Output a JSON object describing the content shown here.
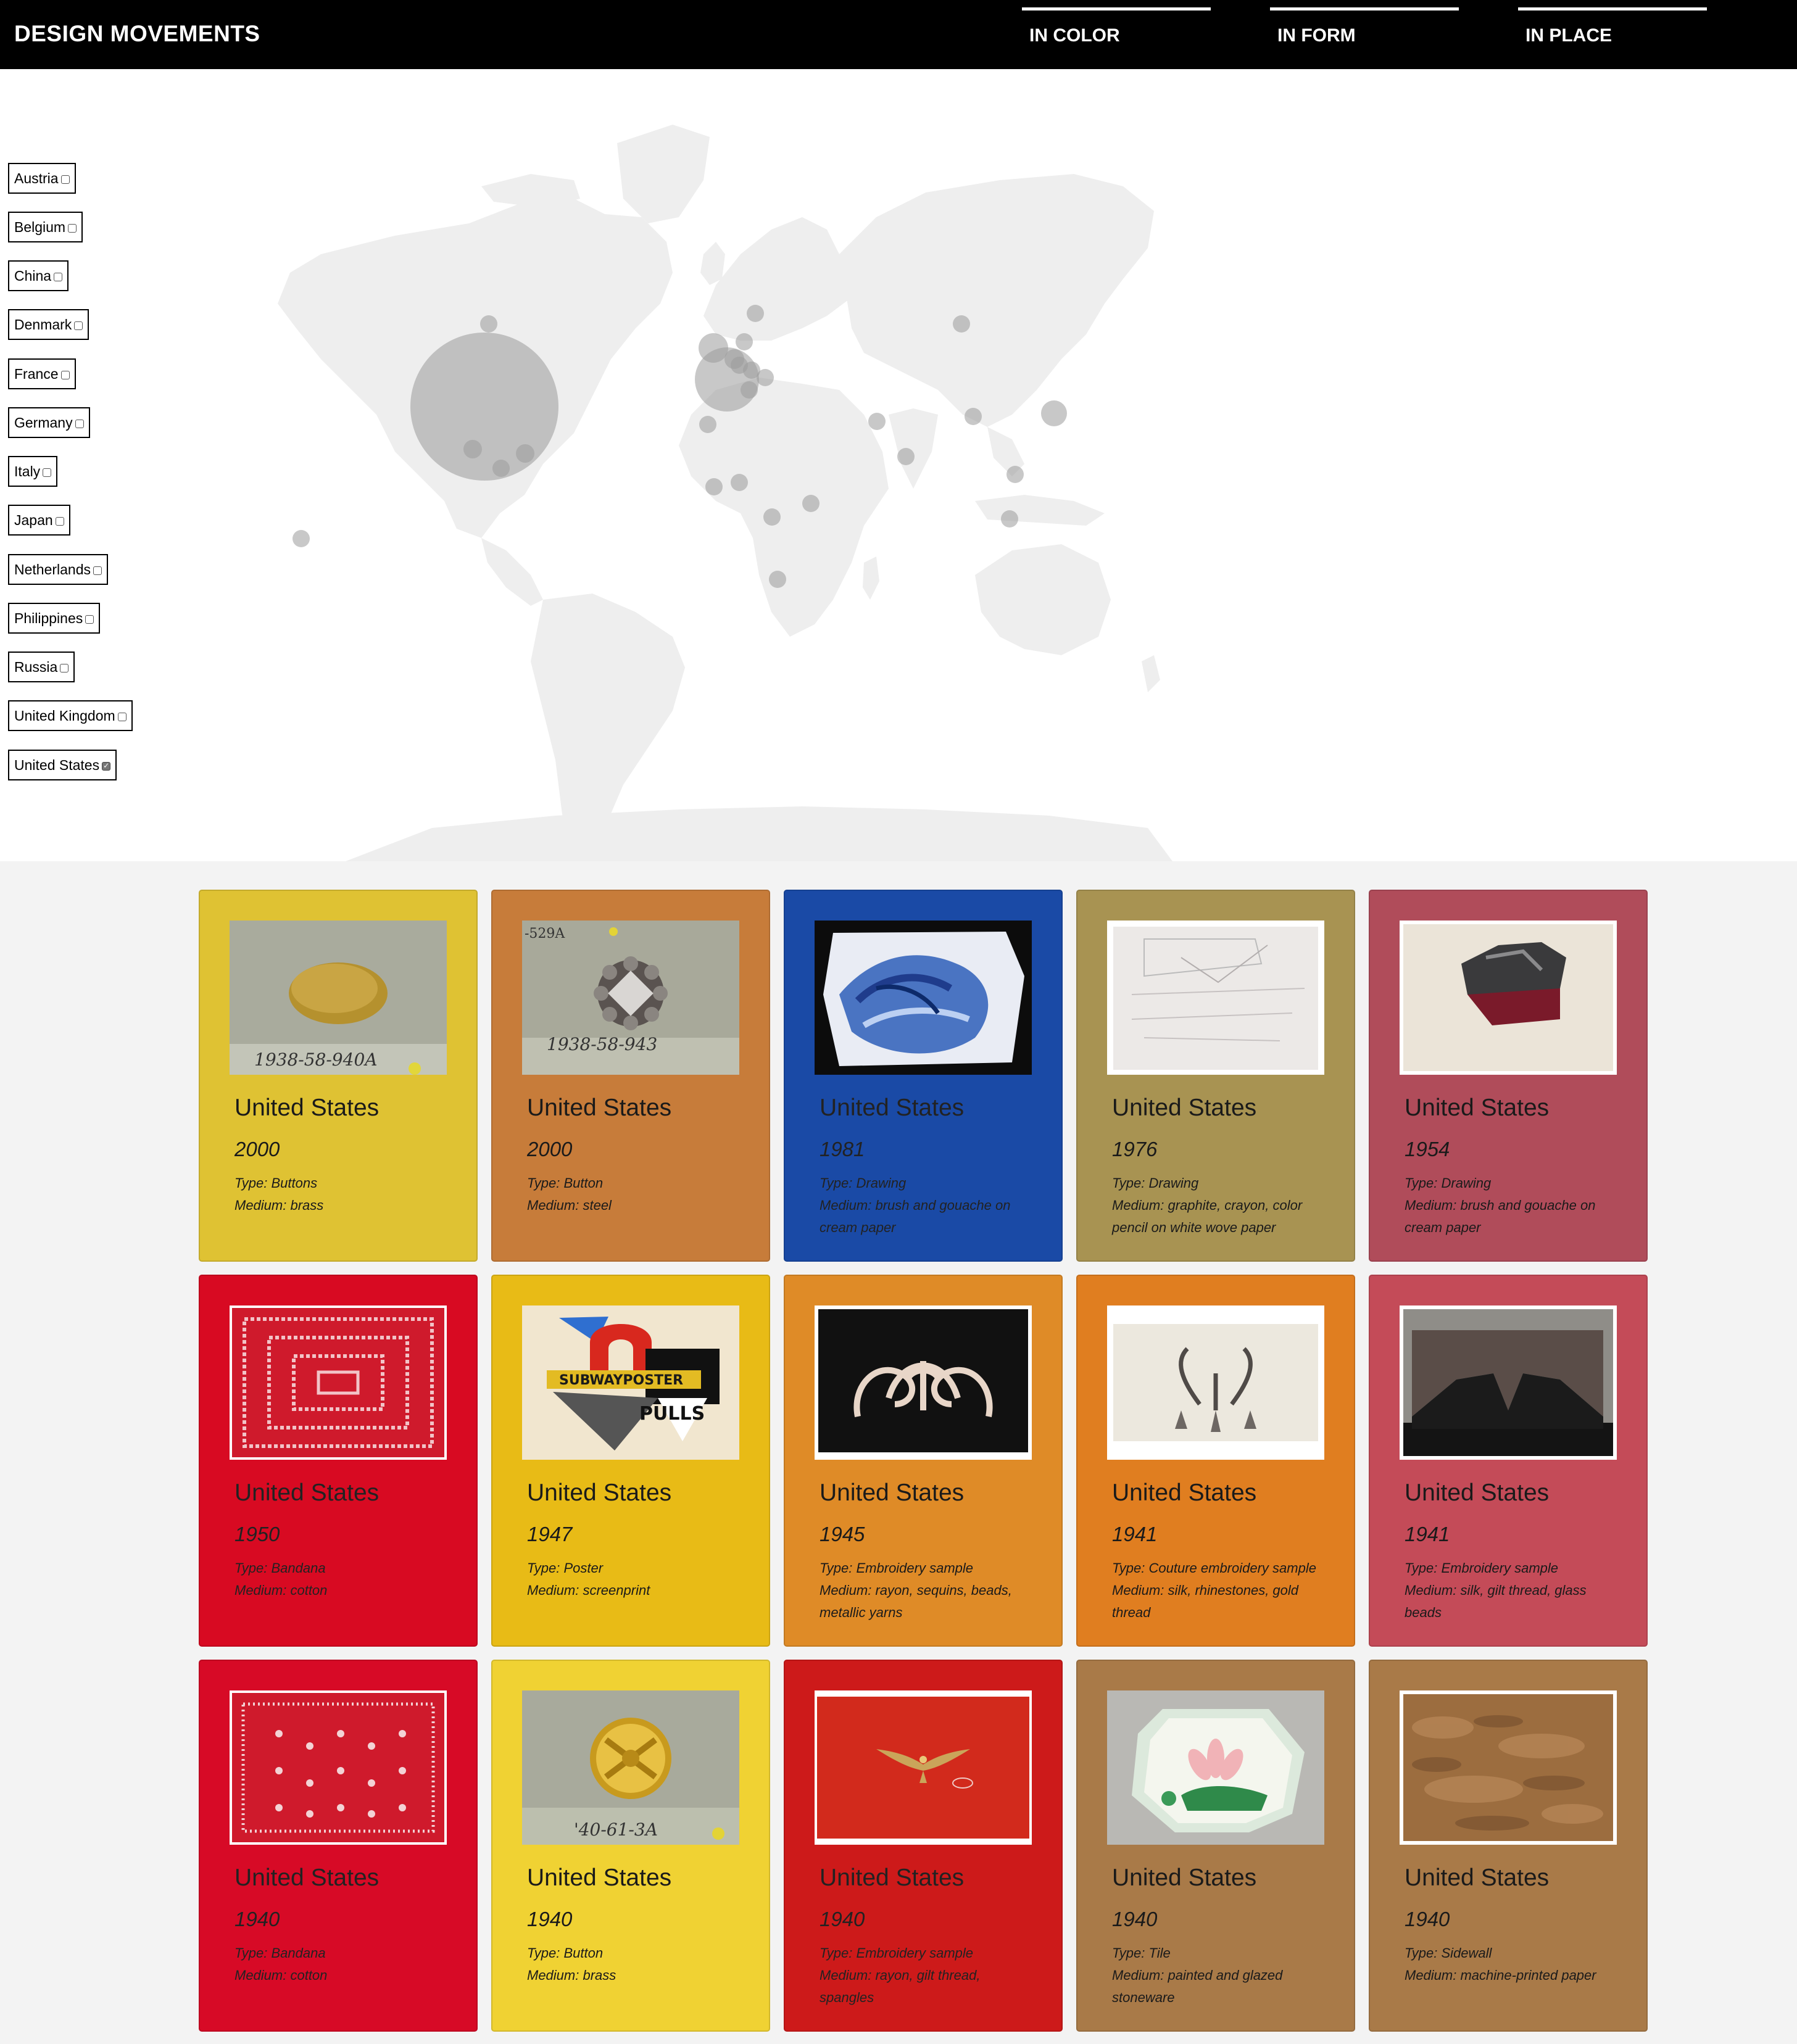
{
  "header": {
    "brand": "DESIGN MOVEMENTS",
    "tabs": [
      "IN COLOR",
      "IN FORM",
      "IN PLACE"
    ]
  },
  "filters": [
    {
      "label": "Austria",
      "checked": false
    },
    {
      "label": "Belgium",
      "checked": false
    },
    {
      "label": "China",
      "checked": false
    },
    {
      "label": "Denmark",
      "checked": false
    },
    {
      "label": "France",
      "checked": false
    },
    {
      "label": "Germany",
      "checked": false
    },
    {
      "label": "Italy",
      "checked": false
    },
    {
      "label": "Japan",
      "checked": false
    },
    {
      "label": "Netherlands",
      "checked": false
    },
    {
      "label": "Philippines",
      "checked": false
    },
    {
      "label": "Russia",
      "checked": false
    },
    {
      "label": "United Kingdom",
      "checked": false
    },
    {
      "label": "United States",
      "checked": true
    }
  ],
  "cards": [
    {
      "country": "United States",
      "year": "2000",
      "type": "Type: Buttons",
      "medium": "Medium: brass",
      "color": "#dfc233",
      "image": "brass-button"
    },
    {
      "country": "United States",
      "year": "2000",
      "type": "Type: Button",
      "medium": "Medium: steel",
      "color": "#c77c3a",
      "image": "steel-button"
    },
    {
      "country": "United States",
      "year": "1981",
      "type": "Type: Drawing",
      "medium": "Medium: brush and gouache on cream paper",
      "color": "#1a4aa6",
      "image": "blue-drawing"
    },
    {
      "country": "United States",
      "year": "1976",
      "type": "Type: Drawing",
      "medium": "Medium: graphite, crayon, color pencil on white wove paper",
      "color": "#a89352",
      "image": "sketch-drawing"
    },
    {
      "country": "United States",
      "year": "1954",
      "type": "Type: Drawing",
      "medium": "Medium: brush and gouache on cream paper",
      "color": "#b04c5a",
      "image": "dark-drawing"
    },
    {
      "country": "United States",
      "year": "1950",
      "type": "Type: Bandana",
      "medium": "Medium: cotton",
      "color": "#d80a22",
      "image": "bandana"
    },
    {
      "country": "United States",
      "year": "1947",
      "type": "Type: Poster",
      "medium": "Medium: screenprint",
      "color": "#e8bb16",
      "image": "poster"
    },
    {
      "country": "United States",
      "year": "1945",
      "type": "Type: Embroidery sample",
      "medium": "Medium: rayon, sequins, beads, metallic yarns",
      "color": "#df8b27",
      "image": "embroidery-black"
    },
    {
      "country": "United States",
      "year": "1941",
      "type": "Type: Couture embroidery sample",
      "medium": "Medium: silk, rhinestones, gold thread",
      "color": "#e07e20",
      "image": "couture"
    },
    {
      "country": "United States",
      "year": "1941",
      "type": "Type: Embroidery sample",
      "medium": "Medium: silk, gilt thread, glass beads",
      "color": "#c44b58",
      "image": "lace"
    },
    {
      "country": "United States",
      "year": "1940",
      "type": "Type: Bandana",
      "medium": "Medium: cotton",
      "color": "#d70a26",
      "image": "bandana2"
    },
    {
      "country": "United States",
      "year": "1940",
      "type": "Type: Button",
      "medium": "Medium: brass",
      "color": "#f0d233",
      "image": "gold-button"
    },
    {
      "country": "United States",
      "year": "1940",
      "type": "Type: Embroidery sample",
      "medium": "Medium: rayon, gilt thread, spangles",
      "color": "#cd1a1a",
      "image": "eagle"
    },
    {
      "country": "United States",
      "year": "1940",
      "type": "Type: Tile",
      "medium": "Medium: painted and glazed stoneware",
      "color": "#a97a48",
      "image": "tile"
    },
    {
      "country": "United States",
      "year": "1940",
      "type": "Type: Sidewall",
      "medium": "Medium: machine-printed paper",
      "color": "#a97a48",
      "image": "sidewall"
    }
  ],
  "map_bubbles": [
    {
      "place": "North America (United States)",
      "count": "large"
    },
    {
      "place": "Europe",
      "count": "medium"
    }
  ]
}
